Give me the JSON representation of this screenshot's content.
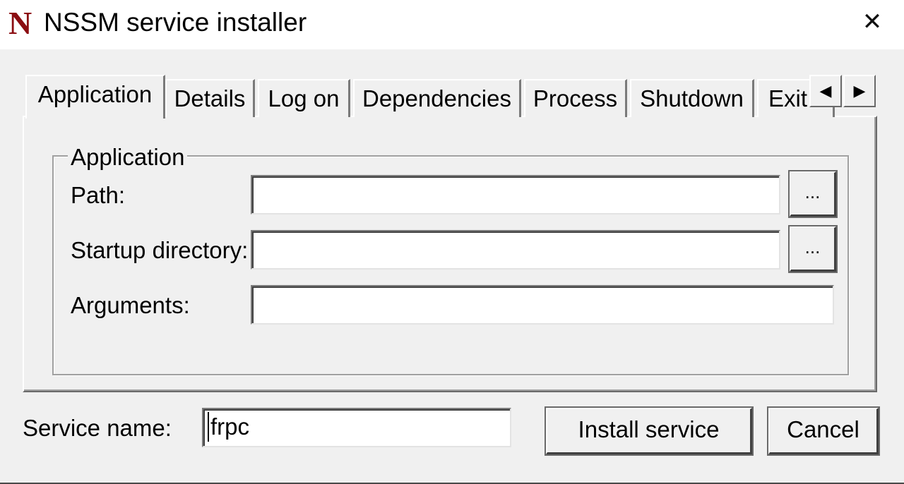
{
  "window": {
    "logo": "N",
    "title": "NSSM service installer",
    "close_glyph": "✕"
  },
  "tabs": [
    {
      "label": "Application",
      "active": true
    },
    {
      "label": "Details",
      "active": false
    },
    {
      "label": "Log on",
      "active": false
    },
    {
      "label": "Dependencies",
      "active": false
    },
    {
      "label": "Process",
      "active": false
    },
    {
      "label": "Shutdown",
      "active": false
    },
    {
      "label": "Exit actions",
      "active": false
    }
  ],
  "tab_scroll": {
    "left_glyph": "◀",
    "right_glyph": "▶"
  },
  "application_group": {
    "legend": "Application",
    "path_label": "Path:",
    "path_value": "",
    "startup_label": "Startup directory:",
    "startup_value": "",
    "arguments_label": "Arguments:",
    "arguments_value": "",
    "browse_label": "..."
  },
  "footer": {
    "service_name_label": "Service name:",
    "service_name_value": "frpc",
    "install_label": "Install service",
    "cancel_label": "Cancel"
  },
  "colors": {
    "logo": "#8b0d12",
    "face": "#f0f0f0",
    "titlebar": "#ffffff"
  }
}
